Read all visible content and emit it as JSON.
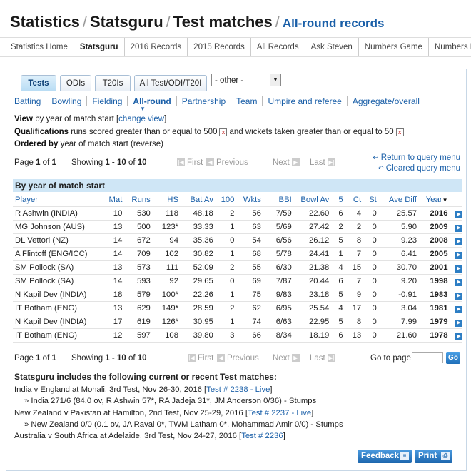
{
  "header": {
    "crumb1": "Statistics",
    "crumb2": "Statsguru",
    "crumb3": "Test matches",
    "subtitle": "All-round records",
    "sep": "/"
  },
  "topnav": [
    "Statistics Home",
    "Statsguru",
    "2016 Records",
    "2015 Records",
    "All Records",
    "Ask Steven",
    "Numbers Game",
    "Numbers Don't Lie"
  ],
  "tabs": [
    "Tests",
    "ODIs",
    "T20Is",
    "All Test/ODI/T20I"
  ],
  "select": {
    "value": "- other -"
  },
  "subnav": [
    "Batting",
    "Bowling",
    "Fielding",
    "All-round",
    "Partnership",
    "Team",
    "Umpire and referee",
    "Aggregate/overall"
  ],
  "query": {
    "view_label": "View",
    "view_text": "by year of match start [",
    "change_view": "change view",
    "view_close": "]",
    "qual_label": "Qualifications",
    "qual_text1": "runs scored greater than or equal to 500",
    "qual_text2": "and wickets taken greater than or equal to 50",
    "ordered_label": "Ordered by",
    "ordered_text": "year of match start (reverse)"
  },
  "pager": {
    "page_label": "Page",
    "page": "1",
    "of": "of",
    "total_pages": "1",
    "showing": "Showing",
    "range": "1 - 10",
    "of2": "of",
    "total": "10",
    "first": "First",
    "previous": "Previous",
    "next": "Next",
    "last": "Last",
    "return_query": "Return to query menu",
    "cleared_query": "Cleared query menu",
    "goto_label": "Go to page",
    "go": "Go"
  },
  "table": {
    "title": "By year of match start",
    "headers": [
      "Player",
      "Mat",
      "Runs",
      "HS",
      "Bat Av",
      "100",
      "Wkts",
      "BBI",
      "Bowl Av",
      "5",
      "Ct",
      "St",
      "Ave Diff",
      "Year"
    ],
    "rows": [
      [
        "R Ashwin (INDIA)",
        "10",
        "530",
        "118",
        "48.18",
        "2",
        "56",
        "7/59",
        "22.60",
        "6",
        "4",
        "0",
        "25.57",
        "2016"
      ],
      [
        "MG Johnson (AUS)",
        "13",
        "500",
        "123*",
        "33.33",
        "1",
        "63",
        "5/69",
        "27.42",
        "2",
        "2",
        "0",
        "5.90",
        "2009"
      ],
      [
        "DL Vettori (NZ)",
        "14",
        "672",
        "94",
        "35.36",
        "0",
        "54",
        "6/56",
        "26.12",
        "5",
        "8",
        "0",
        "9.23",
        "2008"
      ],
      [
        "A Flintoff (ENG/ICC)",
        "14",
        "709",
        "102",
        "30.82",
        "1",
        "68",
        "5/78",
        "24.41",
        "1",
        "7",
        "0",
        "6.41",
        "2005"
      ],
      [
        "SM Pollock (SA)",
        "13",
        "573",
        "111",
        "52.09",
        "2",
        "55",
        "6/30",
        "21.38",
        "4",
        "15",
        "0",
        "30.70",
        "2001"
      ],
      [
        "SM Pollock (SA)",
        "14",
        "593",
        "92",
        "29.65",
        "0",
        "69",
        "7/87",
        "20.44",
        "6",
        "7",
        "0",
        "9.20",
        "1998"
      ],
      [
        "N Kapil Dev (INDIA)",
        "18",
        "579",
        "100*",
        "22.26",
        "1",
        "75",
        "9/83",
        "23.18",
        "5",
        "9",
        "0",
        "-0.91",
        "1983"
      ],
      [
        "IT Botham (ENG)",
        "13",
        "629",
        "149*",
        "28.59",
        "2",
        "62",
        "6/95",
        "25.54",
        "4",
        "17",
        "0",
        "3.04",
        "1981"
      ],
      [
        "N Kapil Dev (INDIA)",
        "17",
        "619",
        "126*",
        "30.95",
        "1",
        "74",
        "6/63",
        "22.95",
        "5",
        "8",
        "0",
        "7.99",
        "1979"
      ],
      [
        "IT Botham (ENG)",
        "12",
        "597",
        "108",
        "39.80",
        "3",
        "66",
        "8/34",
        "18.19",
        "6",
        "13",
        "0",
        "21.60",
        "1978"
      ]
    ]
  },
  "includes": {
    "title": "Statsguru includes the following current or recent Test matches:",
    "m1": "India v England at Mohali, 3rd Test, Nov 26-30, 2016 [",
    "m1_link": "Test # 2238 - Live",
    "m1_detail": "» India 271/6 (84.0 ov, R Ashwin 57*, RA Jadeja 31*, JM Anderson 0/36) - Stumps",
    "m2": "New Zealand v Pakistan at Hamilton, 2nd Test, Nov 25-29, 2016 [",
    "m2_link": "Test # 2237 - Live",
    "m2_detail": "» New Zealand 0/0 (0.1 ov, JA Raval 0*, TWM Latham 0*, Mohammad Amir 0/0) - Stumps",
    "m3": "Australia v South Africa at Adelaide, 3rd Test, Nov 24-27, 2016 [",
    "m3_link": "Test # 2236",
    "close": "]"
  },
  "buttons": {
    "feedback": "Feedback",
    "print": "Print"
  }
}
